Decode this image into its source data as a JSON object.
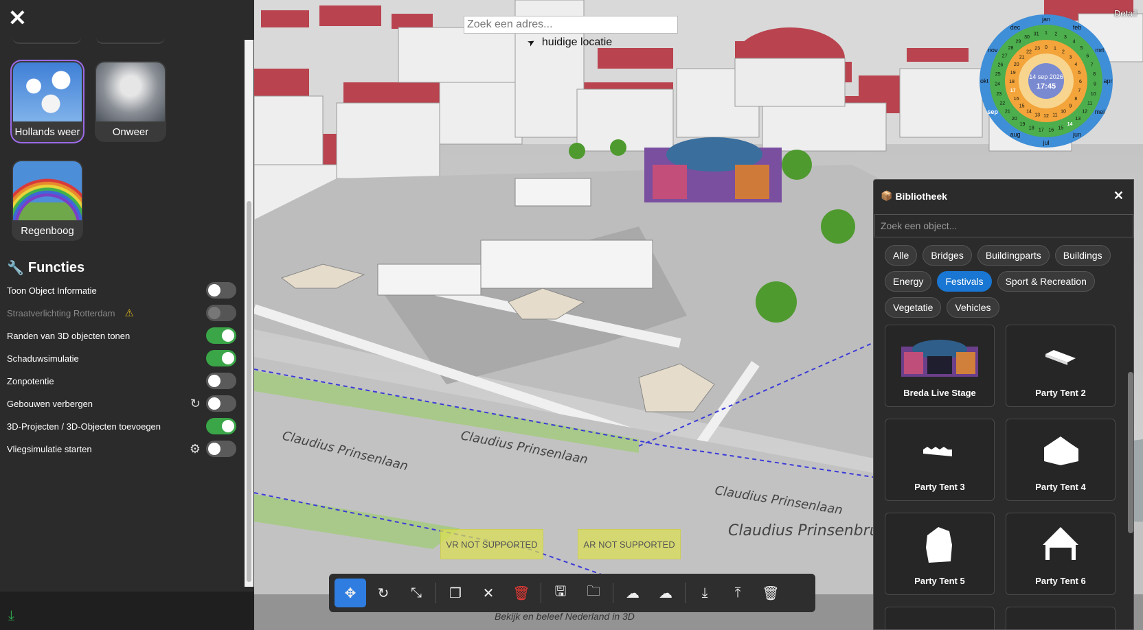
{
  "map": {
    "search_placeholder": "Zoek een adres...",
    "current_location": "huidige locatie",
    "vr_label": "VR NOT SUPPORTED",
    "ar_label": "AR NOT SUPPORTED",
    "tagline": "Bekijk en beleef Nederland in 3D",
    "street_labels": [
      "Claudius Prinsenlaan",
      "Claudius Prinsenlaan",
      "Claudius Prinsenlaan",
      "Claudius Prinsenbrug"
    ],
    "toolbar": [
      "move-icon",
      "rotate-icon",
      "scale-icon",
      "copy-icon",
      "deselect-icon",
      "delete-icon",
      "save-icon",
      "folder-icon",
      "upload-cloud-icon",
      "download-cloud-icon",
      "download-icon",
      "upload-icon",
      "trash-icon"
    ]
  },
  "dial": {
    "detail_label": "Detail",
    "date": "14 sep 2026",
    "time": "17:45",
    "months": [
      "jan",
      "feb",
      "mrt",
      "apr",
      "mei",
      "jun",
      "jul",
      "aug",
      "sep",
      "okt",
      "nov",
      "dec"
    ],
    "selected_month": "sep",
    "selected_day": "14",
    "selected_hour": "17"
  },
  "sidebar": {
    "weather_tiles": [
      {
        "label": "Hollands weer",
        "selected": true
      },
      {
        "label": "Onweer",
        "selected": false
      },
      {
        "label": "Regenboog",
        "selected": false
      }
    ],
    "functies_title": "Functies",
    "functies": [
      {
        "label": "Toon Object Informatie",
        "state": "off"
      },
      {
        "label": "Straatverlichting Rotterdam",
        "state": "disabled",
        "warning": true
      },
      {
        "label": "Randen van 3D objecten tonen",
        "state": "on"
      },
      {
        "label": "Schaduwsimulatie",
        "state": "on"
      },
      {
        "label": "Zonpotentie",
        "state": "off"
      },
      {
        "label": "Gebouwen verbergen",
        "state": "off",
        "aux_icon": "refresh-icon"
      },
      {
        "label": "3D-Projecten / 3D-Objecten toevoegen",
        "state": "on"
      },
      {
        "label": "Vliegsimulatie starten",
        "state": "off",
        "aux_icon": "gear-icon"
      }
    ]
  },
  "library": {
    "title": "Bibliotheek",
    "search_placeholder": "Zoek een object...",
    "categories": [
      "Alle",
      "Bridges",
      "Buildingparts",
      "Buildings",
      "Energy",
      "Festivals",
      "Sport & Recreation",
      "Vegetatie",
      "Vehicles"
    ],
    "active_category": "Festivals",
    "items": [
      "Breda Live Stage",
      "Party Tent 2",
      "Party Tent 3",
      "Party Tent 4",
      "Party Tent 5",
      "Party Tent 6"
    ]
  },
  "colors": {
    "accent_blue": "#2f7de0",
    "toggle_on": "#3aa648",
    "tile_selected": "#9b6ae8",
    "chip_active": "#1976d2"
  }
}
